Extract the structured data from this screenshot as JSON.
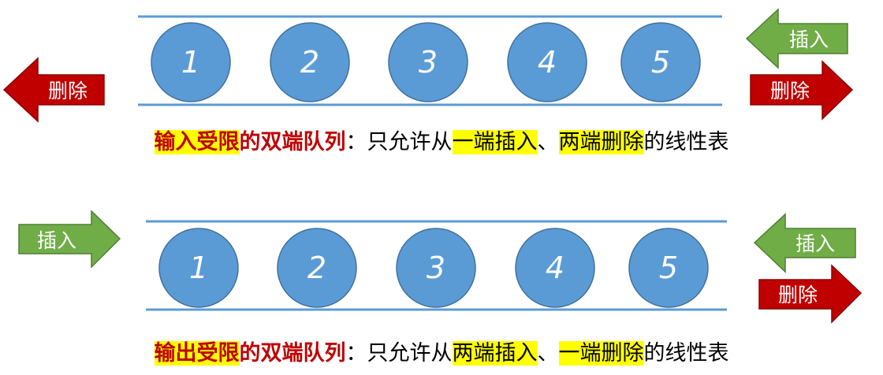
{
  "colors": {
    "rail": "#5b9bd5",
    "circle_fill": "#5b9bd5",
    "circle_stroke": "#41719c",
    "insert_arrow": "#70ad47",
    "insert_arrow_stroke": "#507e32",
    "delete_arrow": "#c00000",
    "delete_arrow_stroke": "#8b0000",
    "term_text": "#c00000",
    "highlight": "#ffff00"
  },
  "diagram1": {
    "elements": [
      "1",
      "2",
      "3",
      "4",
      "5"
    ],
    "arrows": {
      "left_delete": "删除",
      "right_insert": "插入",
      "right_delete": "删除"
    },
    "caption": {
      "term_hl": "输入受限",
      "term_rest": "的双端队列",
      "colon": "：",
      "p1": "只允许从",
      "hl1": "一端插入",
      "sep": "、",
      "hl2": "两端删除",
      "p2": "的线性表"
    }
  },
  "diagram2": {
    "elements": [
      "1",
      "2",
      "3",
      "4",
      "5"
    ],
    "arrows": {
      "left_insert": "插入",
      "right_insert": "插入",
      "right_delete": "删除"
    },
    "caption": {
      "term_hl": "输出受限",
      "term_rest": "的双端队列",
      "colon": "：",
      "p1": "只允许从",
      "hl1": "两端插入",
      "sep": "、",
      "hl2": "一端删除",
      "p2": "的线性表"
    }
  }
}
